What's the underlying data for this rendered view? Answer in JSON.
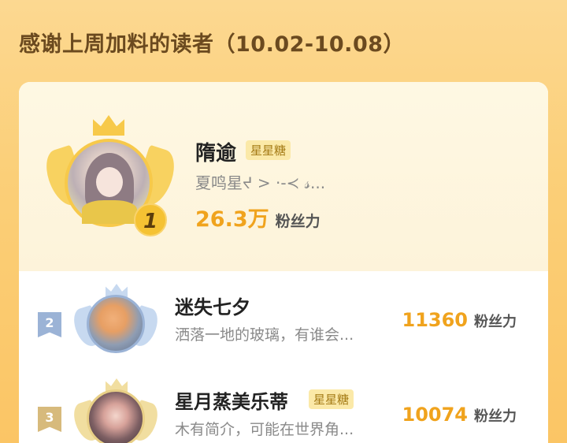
{
  "header": {
    "title": "感谢上周加料的读者（10.02-10.08）"
  },
  "colors": {
    "accent": "#f0a31d",
    "background": "#fbcf78",
    "tag_bg": "#fbe9a8"
  },
  "fans_label": "粉丝力",
  "ranking": [
    {
      "rank": "1",
      "name": "隋逾",
      "tag": "星星糖",
      "bio": "夏鸣星ᔪ > ·-≺ 𝓈...",
      "fans": "26.3万"
    },
    {
      "rank": "2",
      "name": "迷失七夕",
      "tag": "",
      "bio": "洒落一地的玻璃，有谁会...",
      "fans": "11360"
    },
    {
      "rank": "3",
      "name": "星月蒸美乐蒂",
      "tag": "星星糖",
      "bio": "木有简介，可能在世界角...",
      "fans": "10074"
    }
  ]
}
